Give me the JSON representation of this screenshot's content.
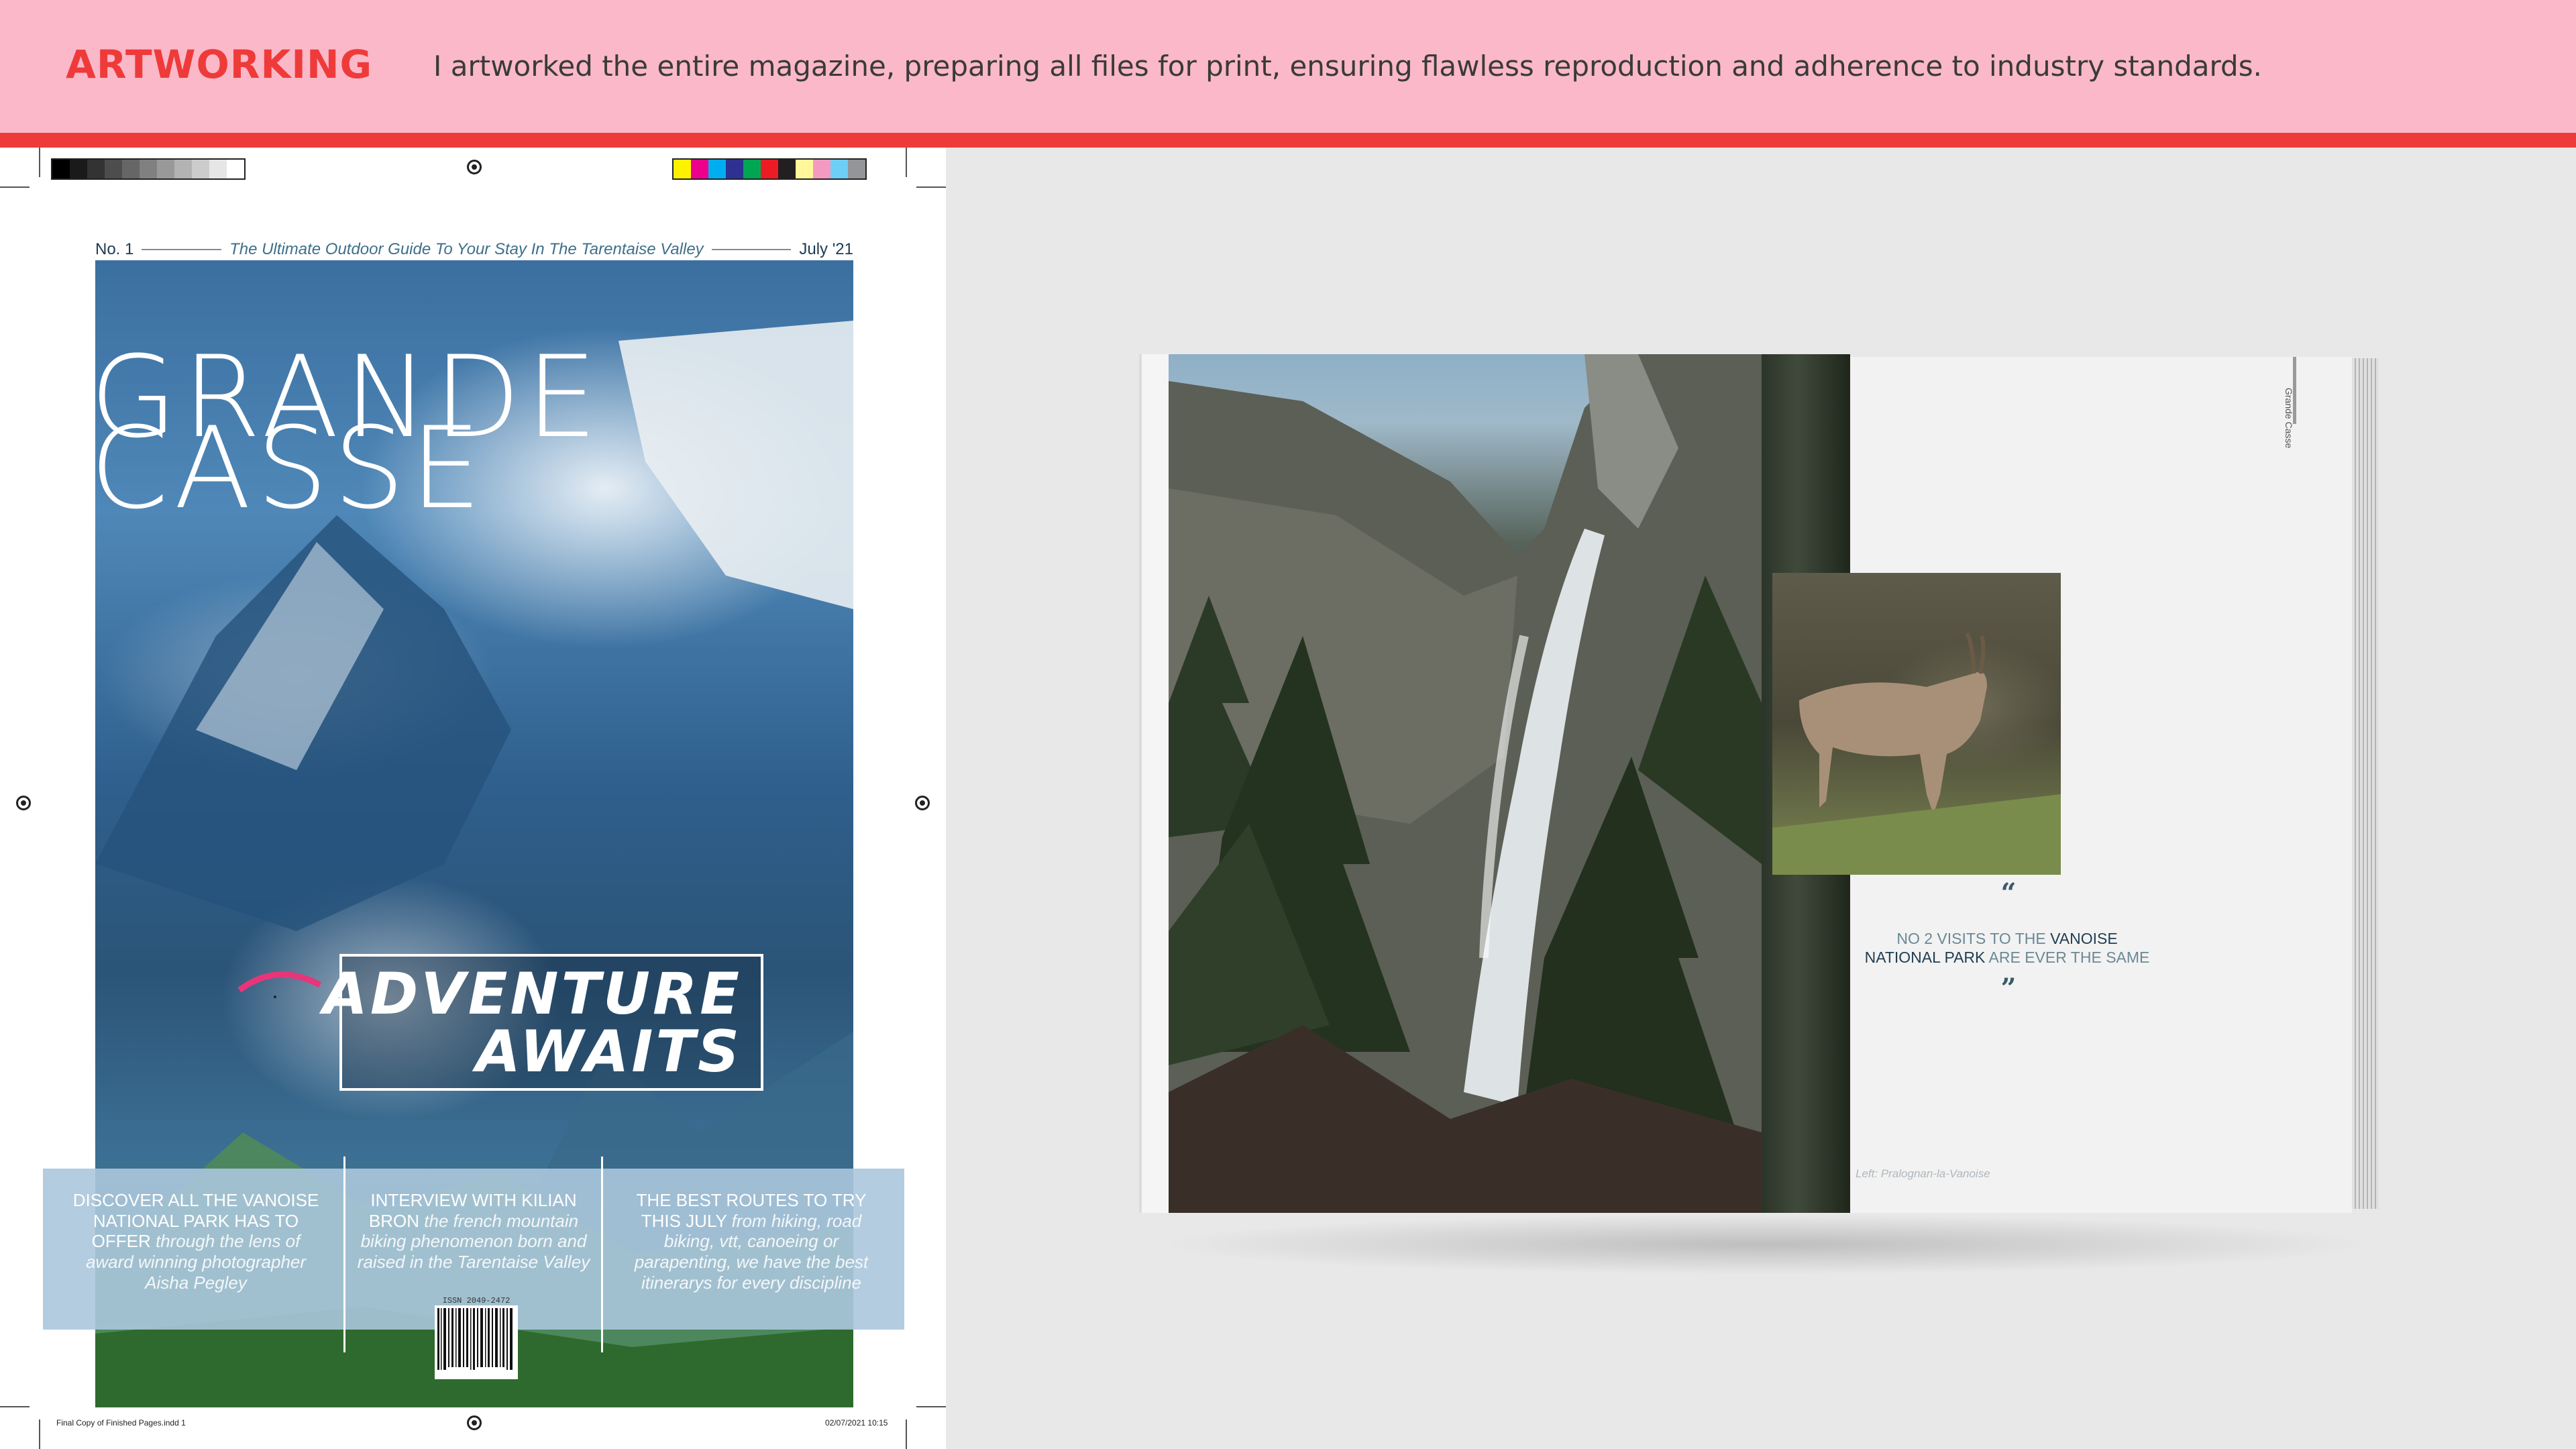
{
  "header": {
    "brand": "ARTWORKING",
    "tagline": "I artworked the entire magazine, preparing all files for print, ensuring flawless reproduction and adherence to industry standards."
  },
  "colors": {
    "header_bg": "#fab8c8",
    "accent_red": "#ee3b3a",
    "canvas_bg": "#e8e8e8"
  },
  "cover": {
    "issue": "No. 1",
    "subtitle": "The Ultimate Outdoor Guide To Your Stay In The Tarentaise Valley",
    "date": "July '21",
    "title_line1": "GRANDE",
    "title_line2": "CASSE",
    "adventure_line1": "ADVENTURE",
    "adventure_line2": "AWAITS",
    "columns": [
      {
        "headline": "DISCOVER ALL THE VANOISE NATIONAL PARK HAS TO OFFER",
        "body": "through the lens of award winning photographer Aisha Pegley"
      },
      {
        "headline": "INTERVIEW WITH KILIAN BRON",
        "body": "the french mountain biking phenomenon born and raised in the Tarentaise Valley"
      },
      {
        "headline": "THE BEST ROUTES TO TRY THIS JULY",
        "body": "from hiking, road biking, vtt, canoeing or parapenting, we have the best itinerarys for every discipline"
      }
    ],
    "issn": "ISSN 2049-2472"
  },
  "print_sheet": {
    "slug_left": "Final Copy of Finished Pages.indd   1",
    "slug_right": "02/07/2021   10:15",
    "gray_swatches": [
      "#000000",
      "#1a1a1a",
      "#333333",
      "#4d4d4d",
      "#666666",
      "#808080",
      "#999999",
      "#b3b3b3",
      "#cccccc",
      "#e6e6e6",
      "#ffffff"
    ],
    "color_swatches": [
      "#fff200",
      "#ec008c",
      "#00aeef",
      "#2e3192",
      "#00a651",
      "#ed1c24",
      "#231f20",
      "#fff799",
      "#f49ac1",
      "#6dcff6",
      "#939598"
    ]
  },
  "spread": {
    "quote_open": "“",
    "quote_line1_pre": "NO 2 VISITS TO THE ",
    "quote_line1_strong": "VANOISE",
    "quote_line2_strong": "NATIONAL PARK",
    "quote_line2_post": " ARE EVER THE SAME",
    "quote_close": "”",
    "running_head": "Grande Casse",
    "caption": "Left: Pralognan-la-Vanoise"
  }
}
